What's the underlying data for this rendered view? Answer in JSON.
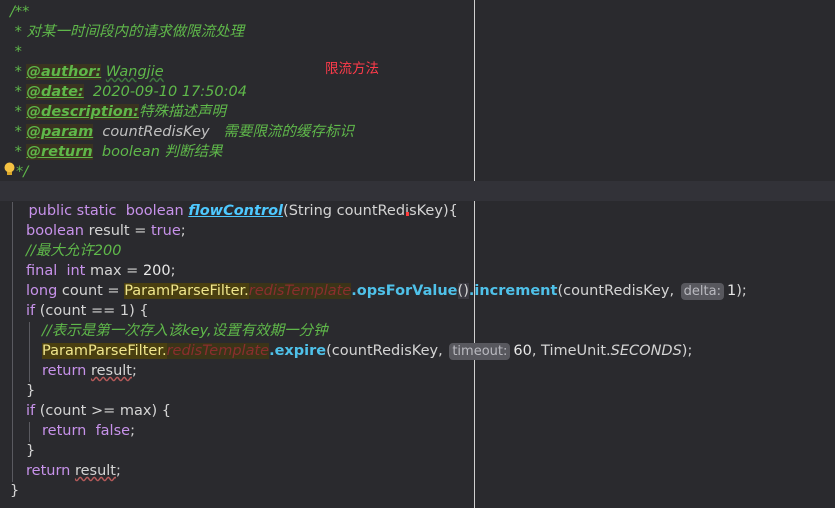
{
  "doc": {
    "open": "/**",
    "summary": " * 对某一时间段内的请求做限流处理",
    "blank": " *",
    "author_tag": "@author:",
    "author_val": "Wangjie",
    "date_tag": "@date:",
    "date_val": "2020-09-10 17:50:04",
    "desc_tag": "@description:",
    "desc_val": "特殊描述声明",
    "param_tag": "@param",
    "param_name": "countRedisKey",
    "param_desc": "需要限流的缓存标识",
    "return_tag": "@return",
    "return_val": "boolean 判断结果",
    "close": "*/",
    "star": " * "
  },
  "note": "限流方法",
  "code": {
    "sig_mods": "public static",
    "sig_type": "boolean",
    "method_name": "flowControl",
    "paren_open": "(",
    "param_type": "String",
    "param_name": "countRedisKey",
    "paren_close": "){",
    "l1_type": "boolean",
    "l1_rest": " result = ",
    "l1_true": "true",
    "l1_end": ";",
    "c1": "//最大允许200",
    "l2_kw": "final",
    "l2_type": "int",
    "l2_rest": " max = ",
    "l2_num": "200",
    "l2_end": ";",
    "l3_type": "long",
    "l3_rest": " count = ",
    "l3_class": "ParamParseFilter.",
    "l3_field": "redisTemplate",
    "l3_m1": ".opsForValue",
    "l3_p1": "()",
    "l3_m2": ".increment",
    "l3_args": "(countRedisKey, ",
    "l3_hint": "delta:",
    "l3_num": "1",
    "l3_end": ");",
    "if1_kw": "if",
    "if1_open": " (",
    "if1_cond": "count == 1",
    "if1_close": ") {",
    "c2": "//表示是第一次存入该key,设置有效期一分钟",
    "l4_class": "ParamParseFilter.",
    "l4_field": "redisTemplate",
    "l4_m": ".expire",
    "l4_args": "(countRedisKey, ",
    "l4_hint": "timeout:",
    "l4_num": "60",
    "l4_sep": ", TimeUnit.",
    "l4_const": "SECONDS",
    "l4_end": ");",
    "ret1_kw": "return",
    "ret1_val": "result",
    "semi": ";",
    "brace_close": "}",
    "if2_kw": "if",
    "if2_open": " (",
    "if2_cond": "count >= max",
    "if2_close": ") {",
    "ret2_kw": "return",
    "ret2_val": "false",
    "ret3_kw": "return",
    "ret3_val": "result"
  },
  "colors": {
    "background": "#2a2a2e",
    "doc_green": "#5fb84a",
    "keyword_purple": "#c792ea",
    "method_blue": "#4ec9ff",
    "note_red": "#ff3b4a"
  }
}
